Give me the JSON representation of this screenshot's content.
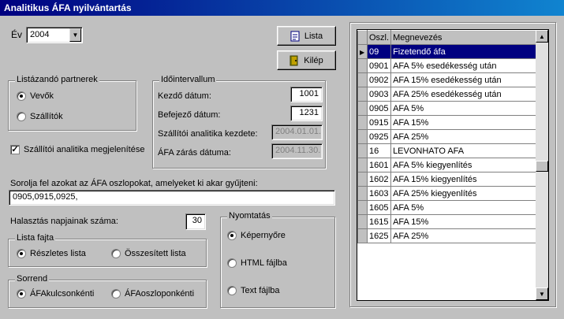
{
  "window": {
    "title": "Analitikus ÁFA nyilvántartás"
  },
  "year": {
    "label": "Év",
    "value": "2004"
  },
  "buttons": {
    "list": "Lista",
    "exit": "Kilép"
  },
  "partners": {
    "title": "Listázandó partnerek",
    "options": [
      "Vevők",
      "Szállítók"
    ],
    "selected": 0
  },
  "interval": {
    "title": "Időintervallum",
    "start_label": "Kezdő dátum:",
    "start_value": "1001",
    "end_label": "Befejező dátum:",
    "end_value": "1231",
    "supplier_start_label": "Szállítói analitika kezdete:",
    "supplier_start_value": "2004.01.01.",
    "vat_close_label": "ÁFA zárás dátuma:",
    "vat_close_value": "2004.11.30."
  },
  "show_supplier_analytics": {
    "label": "Szállítói analitika megjelenítése",
    "checked": true
  },
  "columns_prompt": {
    "label": "Sorolja fel azokat az ÁFA oszlopokat, amelyeket ki akar gyűjteni:",
    "value": "0905,0915,0925,"
  },
  "delay_days": {
    "label": "Halasztás napjainak száma:",
    "value": "30"
  },
  "list_type": {
    "title": "Lista fajta",
    "options": [
      "Részletes lista",
      "Összesített lista"
    ],
    "selected": 0
  },
  "order": {
    "title": "Sorrend",
    "options": [
      "ÁFAkulcsonkénti",
      "ÁFAoszloponkénti"
    ],
    "selected": 0
  },
  "print": {
    "title": "Nyomtatás",
    "options": [
      "Képernyőre",
      "HTML fájlba",
      "Text fájlba"
    ],
    "selected": 0
  },
  "grid": {
    "headers": [
      "Oszl.",
      "Megnevezés"
    ],
    "selected_row": 0,
    "rows": [
      [
        "09",
        "Fizetendő áfa"
      ],
      [
        "0901",
        "AFA 5% esedékesség után"
      ],
      [
        "0902",
        "AFA 15% esedékesség után"
      ],
      [
        "0903",
        "AFA 25% esedékesség után"
      ],
      [
        "0905",
        "AFA  5%"
      ],
      [
        "0915",
        "AFA 15%"
      ],
      [
        "0925",
        "AFA 25%"
      ],
      [
        "16",
        "LEVONHATO AFA"
      ],
      [
        "1601",
        "AFA  5% kiegyenlítés"
      ],
      [
        "1602",
        "AFA 15%  kiegyenlítés"
      ],
      [
        "1603",
        "AFA 25%  kiegyenlítés"
      ],
      [
        "1605",
        "AFA  5%"
      ],
      [
        "1615",
        "AFA 15%"
      ],
      [
        "1625",
        "AFA 25%"
      ]
    ]
  }
}
